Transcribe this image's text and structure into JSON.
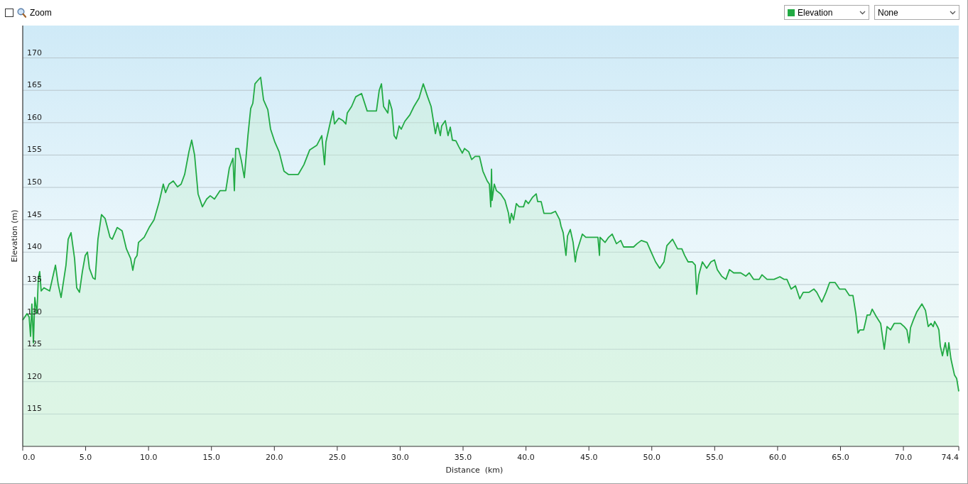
{
  "toolbar": {
    "zoom": {
      "label": "Zoom",
      "checked": false
    },
    "series_select": {
      "value": "Elevation"
    },
    "compare_select": {
      "value": "None"
    }
  },
  "chart": {
    "chart_data": {
      "type": "area",
      "grid": true,
      "xlabel": "Distance  (km)",
      "ylabel": "Elevation (m)",
      "xlim": [
        0,
        74.4
      ],
      "ylim": [
        110,
        175
      ],
      "xticks": [
        {
          "value": 0,
          "label": "0.0"
        },
        {
          "value": 5,
          "label": "5.0"
        },
        {
          "value": 10,
          "label": "10.0"
        },
        {
          "value": 15,
          "label": "15.0"
        },
        {
          "value": 20,
          "label": "20.0"
        },
        {
          "value": 25,
          "label": "25.0"
        },
        {
          "value": 30,
          "label": "30.0"
        },
        {
          "value": 35,
          "label": "35.0"
        },
        {
          "value": 40,
          "label": "40.0"
        },
        {
          "value": 45,
          "label": "45.0"
        },
        {
          "value": 50,
          "label": "50.0"
        },
        {
          "value": 55,
          "label": "55.0"
        },
        {
          "value": 60,
          "label": "60.0"
        },
        {
          "value": 65,
          "label": "65.0"
        },
        {
          "value": 70,
          "label": "70.0"
        },
        {
          "value": 74.4,
          "label": "74.4"
        }
      ],
      "yticks": [
        115,
        120,
        125,
        130,
        135,
        140,
        145,
        150,
        155,
        160,
        165,
        170
      ],
      "x": [
        0,
        0.34,
        0.51,
        0.62,
        0.73,
        0.85,
        0.96,
        1.13,
        1.24,
        1.35,
        1.47,
        1.69,
        2.14,
        2.43,
        2.6,
        2.82,
        3.05,
        3.44,
        3.61,
        3.84,
        4.12,
        4.29,
        4.51,
        4.74,
        4.97,
        5.14,
        5.3,
        5.59,
        5.76,
        5.98,
        6.26,
        6.55,
        6.94,
        7.11,
        7.51,
        7.9,
        8.24,
        8.58,
        8.75,
        8.92,
        9.09,
        9.2,
        9.65,
        10.05,
        10.44,
        10.84,
        11.17,
        11.35,
        11.63,
        11.97,
        12.3,
        12.59,
        12.87,
        13.21,
        13.43,
        13.66,
        13.94,
        14.28,
        14.62,
        14.9,
        15.24,
        15.69,
        16.14,
        16.42,
        16.71,
        16.82,
        16.93,
        17.16,
        17.39,
        17.61,
        17.9,
        18.12,
        18.29,
        18.46,
        18.68,
        18.91,
        19.14,
        19.48,
        19.7,
        20.04,
        20.38,
        20.77,
        21.11,
        21.9,
        22.35,
        22.81,
        23.37,
        23.77,
        23.99,
        24.1,
        24.44,
        24.67,
        24.78,
        25.12,
        25.46,
        25.68,
        25.8,
        26.14,
        26.47,
        26.93,
        27.38,
        28.11,
        28.34,
        28.51,
        28.68,
        29.02,
        29.13,
        29.35,
        29.52,
        29.69,
        29.92,
        30.09,
        30.37,
        30.77,
        31.1,
        31.5,
        31.84,
        32.18,
        32.46,
        32.8,
        32.97,
        33.19,
        33.3,
        33.59,
        33.81,
        33.98,
        34.15,
        34.43,
        34.66,
        34.94,
        35.11,
        35.45,
        35.68,
        35.96,
        36.3,
        36.58,
        36.92,
        37.09,
        37.2,
        37.26,
        37.31,
        37.48,
        37.65,
        37.99,
        38.33,
        38.61,
        38.72,
        38.84,
        39.01,
        39.23,
        39.46,
        39.8,
        39.97,
        40.19,
        40.53,
        40.81,
        40.93,
        41.21,
        41.43,
        42,
        42.34,
        42.68,
        42.79,
        42.96,
        43.18,
        43.3,
        43.52,
        43.75,
        43.92,
        44.03,
        44.48,
        44.76,
        44.88,
        45.72,
        45.84,
        45.89,
        46.29,
        46.57,
        46.85,
        47.19,
        47.53,
        47.76,
        48.55,
        48.83,
        49.17,
        49.62,
        49.96,
        50.3,
        50.63,
        50.97,
        51.2,
        51.65,
        52.05,
        52.39,
        52.61,
        52.89,
        53.23,
        53.46,
        53.57,
        53.74,
        54.02,
        54.36,
        54.7,
        54.98,
        55.21,
        55.55,
        55.89,
        56.17,
        56.51,
        57.07,
        57.47,
        57.75,
        58.09,
        58.54,
        58.76,
        59.16,
        59.72,
        60.18,
        60.51,
        60.74,
        61.08,
        61.42,
        61.76,
        62.04,
        62.49,
        62.89,
        63.11,
        63.51,
        63.85,
        64.13,
        64.58,
        64.92,
        65.37,
        65.71,
        65.99,
        66.22,
        66.39,
        66.55,
        66.84,
        67.12,
        67.35,
        67.52,
        67.86,
        68.19,
        68.48,
        68.7,
        68.98,
        69.27,
        69.77,
        70.06,
        70.28,
        70.45,
        70.56,
        70.79,
        71.07,
        71.47,
        71.75,
        71.97,
        72.2,
        72.37,
        72.48,
        72.71,
        72.82,
        72.93,
        73.1,
        73.33,
        73.5,
        73.61,
        73.78,
        73.89,
        74.06,
        74.23,
        74.4
      ],
      "series": [
        {
          "color": "#22aa44",
          "values": [
            129.5,
            130.5,
            130,
            127,
            132,
            126,
            133,
            130.5,
            136,
            137,
            134,
            134.5,
            134,
            136.5,
            138,
            135,
            133,
            138,
            142,
            143,
            139,
            134.5,
            133.8,
            137,
            139.5,
            140,
            137.5,
            136,
            135.8,
            142,
            145.8,
            145.2,
            142.3,
            142,
            143.8,
            143.3,
            140.5,
            139,
            137.2,
            139,
            139.5,
            141.5,
            142.3,
            143.8,
            145,
            147.7,
            150.5,
            149.2,
            150.5,
            151,
            150.1,
            150.5,
            152,
            155.5,
            157.3,
            155,
            149,
            147,
            148.2,
            148.7,
            148.2,
            149.5,
            149.5,
            153,
            154.5,
            149.5,
            156,
            156,
            154,
            151.5,
            158,
            162.2,
            163,
            166,
            166.5,
            167,
            163.5,
            162,
            159,
            157,
            155.5,
            152.5,
            152,
            152,
            153.5,
            155.8,
            156.5,
            158,
            153.5,
            157,
            160,
            161.8,
            159.8,
            160.7,
            160.3,
            159.8,
            161.5,
            162.5,
            164,
            164.5,
            161.8,
            161.8,
            165,
            166,
            162.5,
            161.5,
            163.5,
            162,
            158,
            157.5,
            159.5,
            159,
            160.2,
            161.2,
            162.5,
            163.8,
            166,
            164,
            162.5,
            158.3,
            160,
            158,
            159.5,
            160.3,
            158,
            159.3,
            157.3,
            157.2,
            156.3,
            155.3,
            156,
            155.5,
            154.3,
            154.8,
            154.8,
            152.5,
            151,
            150.5,
            147,
            152.8,
            148,
            150.5,
            149.5,
            149,
            148,
            146,
            144.5,
            146,
            145,
            147.5,
            147,
            147,
            148,
            147.5,
            148.5,
            149,
            147.8,
            147.8,
            146,
            146,
            146.3,
            145,
            144,
            143,
            139.5,
            142.5,
            143.5,
            141.5,
            138.5,
            140,
            142.8,
            142.3,
            142.3,
            142.3,
            139.5,
            142.3,
            141.5,
            142.3,
            142.8,
            141.3,
            141.8,
            140.8,
            140.8,
            141.3,
            141.8,
            141.5,
            140,
            138.5,
            137.5,
            138.5,
            141,
            142,
            140.5,
            140.5,
            139.5,
            138.5,
            138.5,
            138,
            133.5,
            136.5,
            138.5,
            137.5,
            138.5,
            138.8,
            137.3,
            136.3,
            135.8,
            137.3,
            136.8,
            136.8,
            136.3,
            136.8,
            135.8,
            135.8,
            136.5,
            135.8,
            135.8,
            136.2,
            135.8,
            135.8,
            134.3,
            134.8,
            132.8,
            133.8,
            133.8,
            134.3,
            133.8,
            132.3,
            133.8,
            135.3,
            135.3,
            134.3,
            134.3,
            133.3,
            133.3,
            130.5,
            127.5,
            128,
            128,
            130.3,
            130.3,
            131.2,
            130,
            129,
            125,
            128.5,
            128,
            129,
            129,
            128.5,
            128,
            126,
            128.3,
            129.5,
            130.8,
            132,
            131,
            128.5,
            129,
            128.5,
            129.3,
            128.5,
            128,
            125.5,
            124,
            126,
            124,
            126,
            123.5,
            122.5,
            121,
            120.5,
            118.5
          ]
        }
      ]
    }
  }
}
